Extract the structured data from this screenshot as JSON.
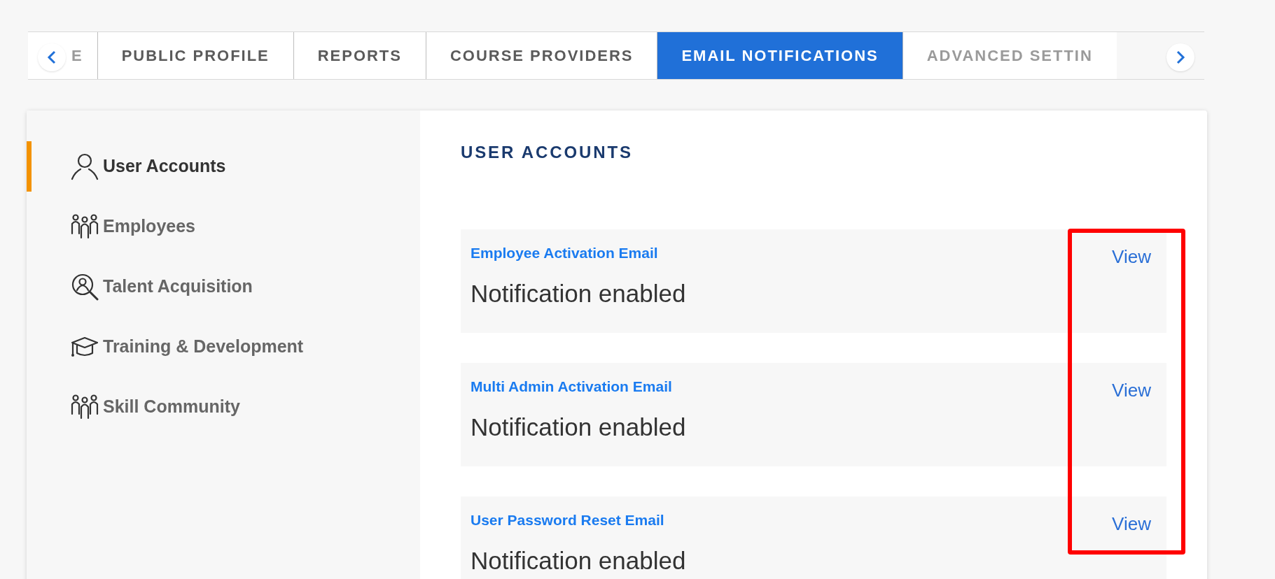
{
  "tabs": [
    {
      "label": "E",
      "selected": false
    },
    {
      "label": "PUBLIC PROFILE",
      "selected": false
    },
    {
      "label": "REPORTS",
      "selected": false
    },
    {
      "label": "COURSE PROVIDERS",
      "selected": false
    },
    {
      "label": "EMAIL NOTIFICATIONS",
      "selected": true
    },
    {
      "label": "ADVANCED SETTIN",
      "selected": false
    }
  ],
  "sidebar": {
    "items": [
      {
        "label": "User Accounts",
        "kind": "user",
        "selected": true
      },
      {
        "label": "Employees",
        "kind": "group",
        "selected": false
      },
      {
        "label": "Talent Acquisition",
        "kind": "search",
        "selected": false
      },
      {
        "label": "Training & Development",
        "kind": "training",
        "selected": false
      },
      {
        "label": "Skill Community",
        "kind": "group",
        "selected": false
      }
    ]
  },
  "section": {
    "title": "USER ACCOUNTS",
    "notifications": [
      {
        "title": "Employee Activation Email",
        "status": "Notification enabled",
        "action": "View"
      },
      {
        "title": "Multi Admin Activation Email",
        "status": "Notification enabled",
        "action": "View"
      },
      {
        "title": "User Password Reset Email",
        "status": "Notification enabled",
        "action": "View"
      }
    ]
  }
}
